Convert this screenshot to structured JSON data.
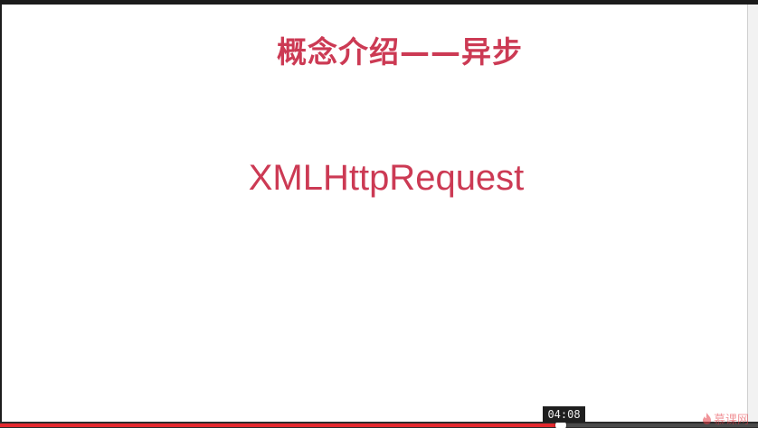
{
  "slide": {
    "title": "概念介绍——异步",
    "term": "XMLHttpRequest"
  },
  "player": {
    "hover_time": "04:08",
    "progress_fraction": 0.74,
    "progress_color": "#e3282e"
  },
  "watermark": {
    "text": "慕课网",
    "icon": "flame-icon",
    "color": "#e63c46"
  },
  "colors": {
    "accent": "#cc3a54",
    "slide_background": "#ffffff",
    "frame": "#1d1d1d"
  }
}
